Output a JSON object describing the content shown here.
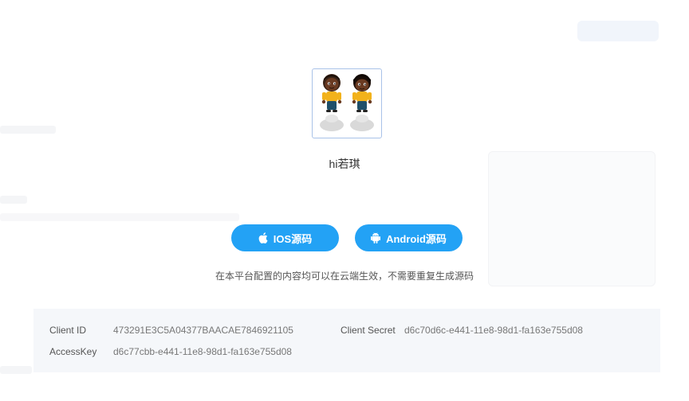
{
  "app": {
    "username": "hi若琪",
    "avatar_icon": "twin-cartoon-kids-avatar"
  },
  "actions": {
    "ios_label": "IOS源码",
    "ios_icon": "apple-icon",
    "android_label": "Android源码",
    "android_icon": "android-icon",
    "accent_color": "#23a2f5"
  },
  "notice": "在本平台配置的内容均可以在云端生效，不需要重复生成源码",
  "credentials": {
    "client_id_label": "Client ID",
    "client_id": "473291E3C5A04377BAACAE7846921105",
    "client_secret_label": "Client Secret",
    "client_secret": "d6c70d6c-e441-11e8-98d1-fa163e755d08",
    "access_key_label": "AccessKey",
    "access_key": "d6c77cbb-e441-11e8-98d1-fa163e755d08"
  }
}
